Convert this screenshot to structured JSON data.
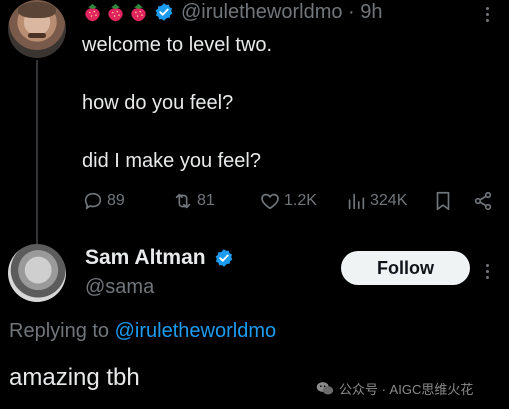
{
  "tweet": {
    "badges": [
      "strawberry-icon",
      "strawberry-icon",
      "strawberry-icon"
    ],
    "handle_time": "@iruletheworldmo · 9h",
    "lines": [
      "welcome to level two.",
      "how do you feel?",
      "did I make you feel?"
    ],
    "actions": {
      "replies": "89",
      "reposts": "81",
      "likes": "1.2K",
      "views": "324K"
    }
  },
  "reply": {
    "name": "Sam Altman",
    "handle": "@sama",
    "follow_label": "Follow",
    "replying_prefix": "Replying to ",
    "replying_handle": "@iruletheworldmo",
    "text": "amazing tbh"
  },
  "watermark": {
    "text": "公众号 · AIGC思维火花"
  },
  "colors": {
    "background": "#000000",
    "text": "#e7e9ea",
    "muted": "#71767b",
    "link": "#1d9bf0",
    "verified": "#1d9bf0",
    "button": "#eff3f4"
  }
}
